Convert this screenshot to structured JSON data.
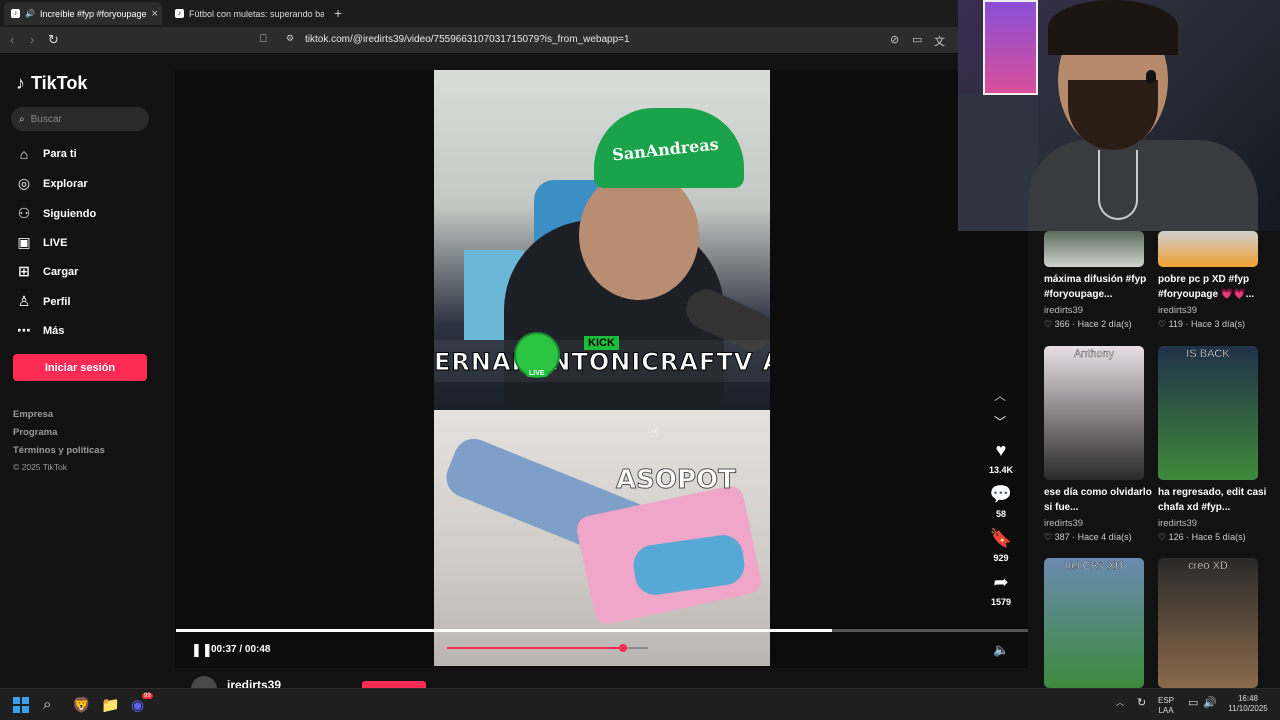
{
  "browser": {
    "tabs": [
      {
        "title": "Increíble #fyp #foryoupage",
        "active": true
      },
      {
        "title": "Fútbol con muletas: superando barre",
        "active": false
      }
    ],
    "url": "tiktok.com/@iredirts39/video/7559663107031715079?is_from_webapp=1"
  },
  "sidebar": {
    "brand": "TikTok",
    "search_placeholder": "Buscar",
    "nav": [
      {
        "label": "Para ti",
        "icon": "home-icon"
      },
      {
        "label": "Explorar",
        "icon": "compass-icon"
      },
      {
        "label": "Siguiendo",
        "icon": "following-icon"
      },
      {
        "label": "LIVE",
        "icon": "live-icon"
      },
      {
        "label": "Cargar",
        "icon": "upload-icon"
      },
      {
        "label": "Perfil",
        "icon": "profile-icon"
      },
      {
        "label": "Más",
        "icon": "more-icon"
      }
    ],
    "login_label": "Iniciar sesión",
    "footer": [
      "Empresa",
      "Programa",
      "Términos y políticas"
    ],
    "copyright": "© 2025 TikTok"
  },
  "player": {
    "time": "00:37 / 00:48",
    "progress": 0.77,
    "video_overlay": {
      "cap_text": "SanAndreas",
      "banner_text": "ERNAI  ANTONICRAFTV  A SO",
      "kick_label": "KICK",
      "live_label": "LIVE",
      "lower_text": "ASOPOT"
    },
    "author": "iredirts39",
    "actions": {
      "likes": "13.4K",
      "comments": "58",
      "saves": "929",
      "shares": "1579"
    }
  },
  "related": [
    {
      "title": "máxima difusión #fyp #foryoupage...",
      "user": "iredirts39",
      "likes": "366",
      "age": "Hace 2 día(s)",
      "thumb_label": "",
      "thumb_colors": [
        "#5a6a5a",
        "#cfd4d0"
      ]
    },
    {
      "title": "pobre pc p XD #fyp #foryoupage 💗💗...",
      "user": "iredirts39",
      "likes": "119",
      "age": "Hace 3 día(s)",
      "thumb_label": "",
      "thumb_colors": [
        "#d0d0d0",
        "#f0a030"
      ]
    },
    {
      "title": "ese día como olvidarlo si fue...",
      "user": "iredirts39",
      "likes": "387",
      "age": "Hace 4 día(s)",
      "thumb_label": "Anthony",
      "thumb_colors": [
        "#e8e0e4",
        "#2a2a2a"
      ]
    },
    {
      "title": "ha regresado, edit casi chafa xd #fyp...",
      "user": "iredirts39",
      "likes": "126",
      "age": "Hace 5 día(s)",
      "thumb_label": "IS BACK",
      "thumb_colors": [
        "#20314a",
        "#3f8a3a"
      ]
    },
    {
      "title": "",
      "user": "",
      "likes": "",
      "age": "",
      "thumb_label": "del CR7 XD",
      "thumb_colors": [
        "#6a8ab0",
        "#3c8a3c"
      ]
    },
    {
      "title": "",
      "user": "",
      "likes": "",
      "age": "",
      "thumb_label": "creo XD",
      "thumb_colors": [
        "#2a2a2a",
        "#8a6a4a"
      ]
    }
  ],
  "taskbar": {
    "lang_top": "ESP",
    "lang_bottom": "LAA",
    "time": "16:48",
    "date": "11/10/2025",
    "discord_badge": "99"
  }
}
